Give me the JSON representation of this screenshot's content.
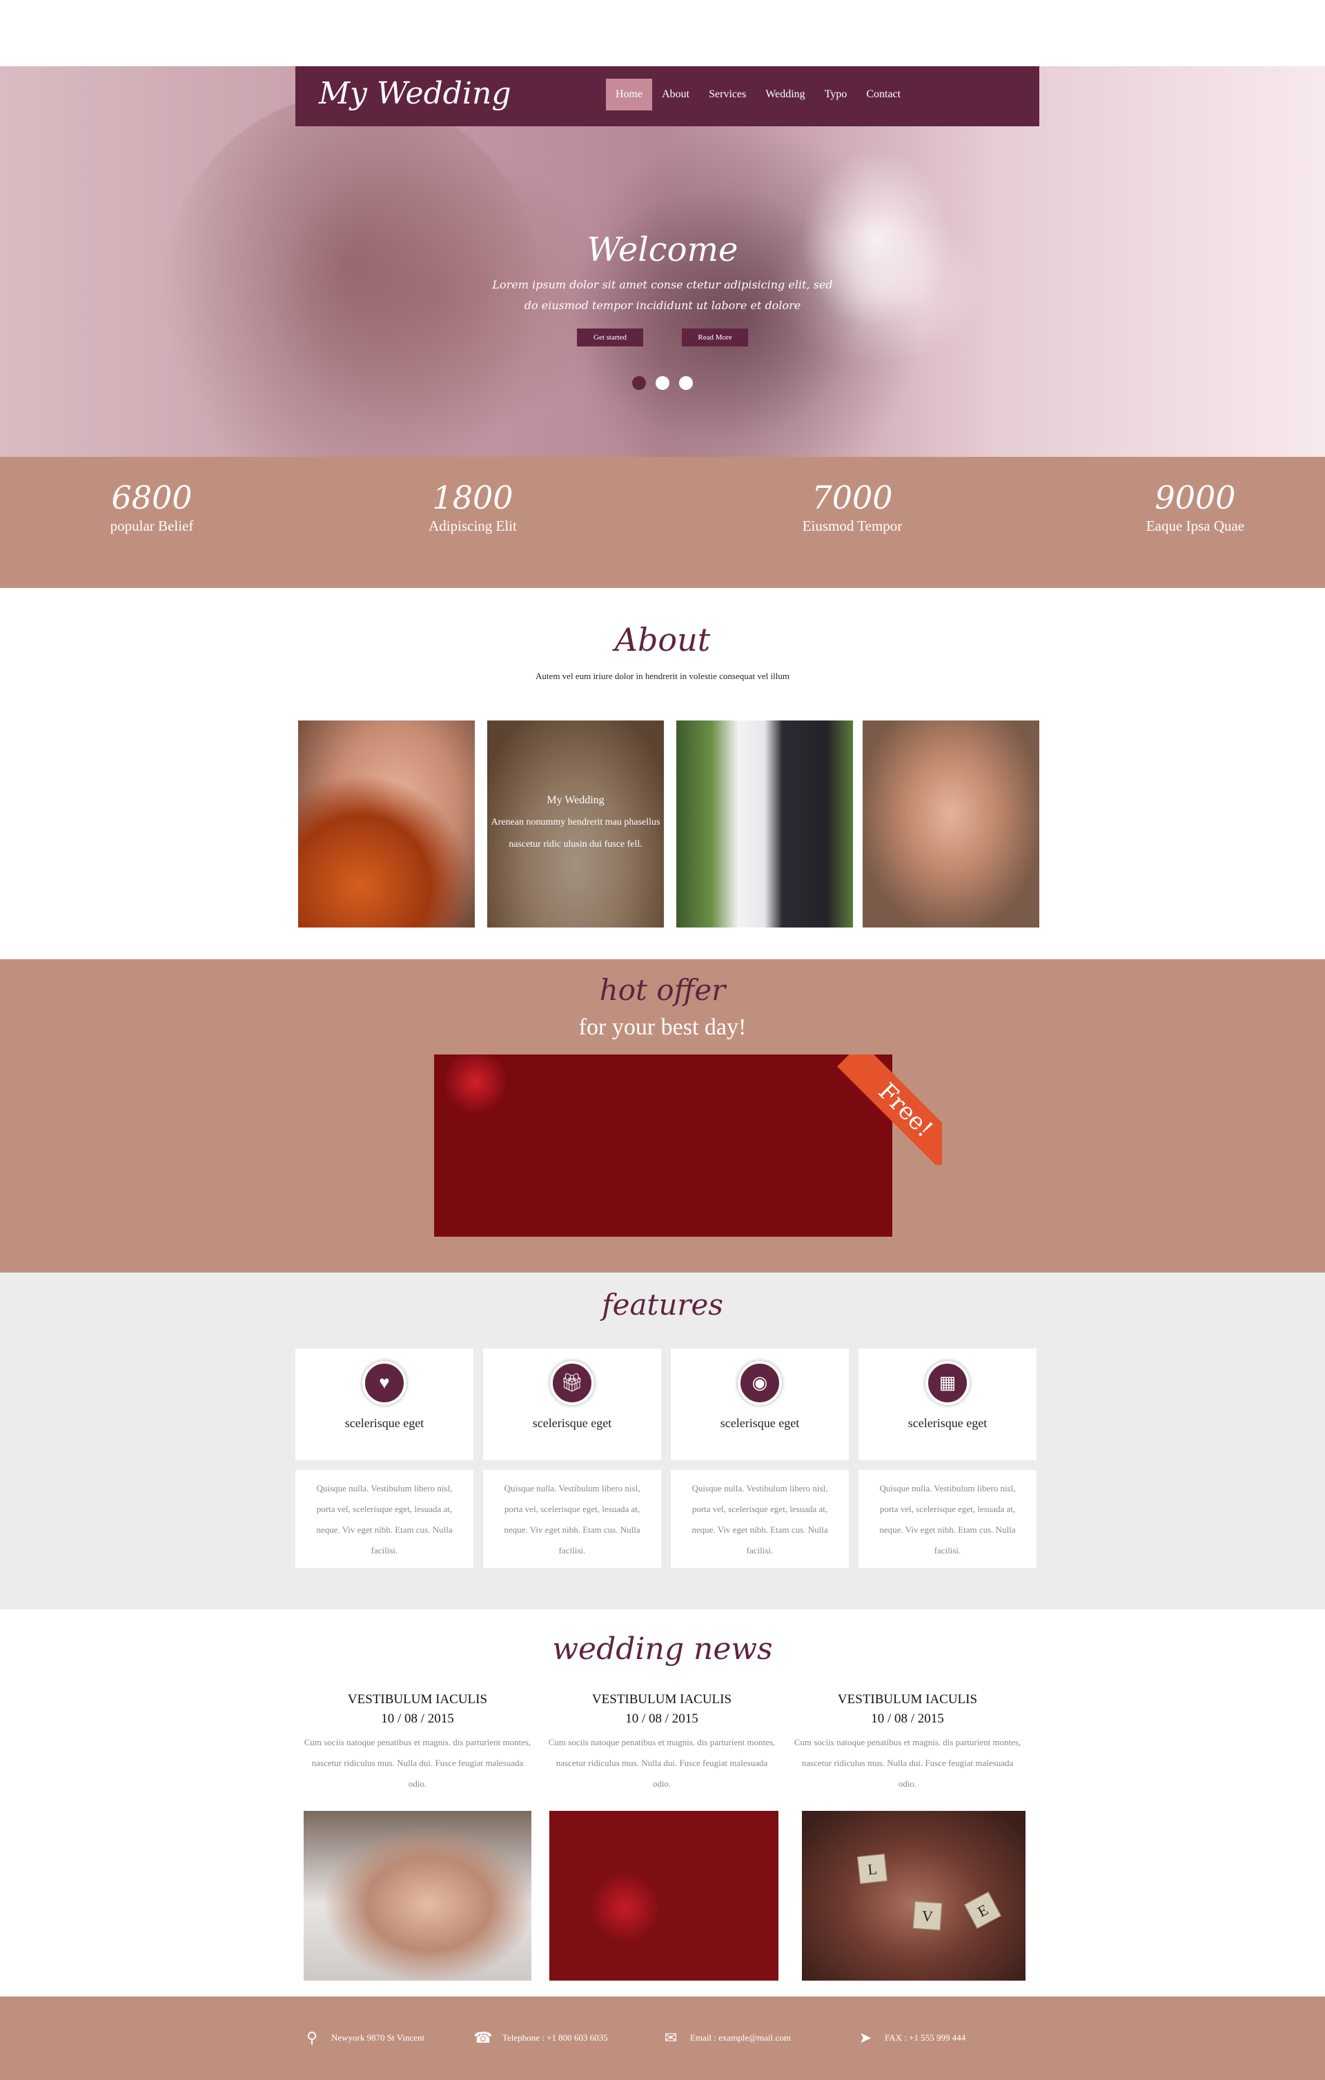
{
  "header": {
    "logo": "My Wedding",
    "nav": [
      {
        "label": "Home",
        "active": true
      },
      {
        "label": "About",
        "active": false
      },
      {
        "label": "Services",
        "active": false
      },
      {
        "label": "Wedding",
        "active": false
      },
      {
        "label": "Typo",
        "active": false
      },
      {
        "label": "Contact",
        "active": false
      }
    ]
  },
  "hero": {
    "title": "Welcome",
    "text": "Lorem ipsum dolor sit amet conse ctetur adipisicing elit, sed do eiusmod tempor incididunt ut labore et dolore",
    "buttons": [
      "Get started",
      "Read More"
    ],
    "slides": 3,
    "active_slide": 0
  },
  "stats": [
    {
      "value": "6800",
      "label": "popular Belief"
    },
    {
      "value": "1800",
      "label": "Adipiscing Elit"
    },
    {
      "value": "7000",
      "label": "Eiusmod Tempor"
    },
    {
      "value": "9000",
      "label": "Eaque Ipsa Quae"
    }
  ],
  "about": {
    "title": "About",
    "subtitle": "Autem vel eum iriure dolor in hendrerit in volestie consequat vel illum",
    "overlay": {
      "title": "My Wedding",
      "text": "Arenean nonummy hendrerit mau phasellus nascetur ridic ulusin dui fusce fell."
    }
  },
  "offer": {
    "title": "hot offer",
    "subtitle": "for your best day!",
    "badge": "Free!"
  },
  "features": {
    "title": "features",
    "items": [
      {
        "icon": "heart-icon",
        "label": "scelerisque eget",
        "text": "Quisque nulla. Vestibulum libero nisl, porta vel, scelerisque eget, lesuada at, neque. Viv eget nibh. Etam cus. Nulla facilisi."
      },
      {
        "icon": "gift-icon",
        "label": "scelerisque eget",
        "text": "Quisque nulla. Vestibulum libero nisl, porta vel, scelerisque eget, lesuada at, neque. Viv eget nibh. Etam cus. Nulla facilisi."
      },
      {
        "icon": "camera-icon",
        "label": "scelerisque eget",
        "text": "Quisque nulla. Vestibulum libero nisl, porta vel, scelerisque eget, lesuada at, neque. Viv eget nibh. Etam cus. Nulla facilisi."
      },
      {
        "icon": "calendar-icon",
        "label": "scelerisque eget",
        "text": "Quisque nulla. Vestibulum libero nisl, porta vel, scelerisque eget, lesuada at, neque. Viv eget nibh. Etam cus. Nulla facilisi."
      }
    ]
  },
  "news": {
    "title": "wedding news",
    "items": [
      {
        "heading": "VESTIBULUM IACULIS",
        "date": "10 / 08 / 2015",
        "text": "Cum sociis natoque penatibus et magnis. dis parturient montes, nascetur ridiculus mus. Nulla dui. Fusce feugiat malesuada odio."
      },
      {
        "heading": "VESTIBULUM IACULIS",
        "date": "10 / 08 / 2015",
        "text": "Cum sociis natoque penatibus et magnis. dis parturient montes, nascetur ridiculus mus. Nulla dui. Fusce feugiat malesuada odio."
      },
      {
        "heading": "VESTIBULUM IACULIS",
        "date": "10 / 08 / 2015",
        "text": "Cum sociis natoque penatibus et magnis. dis parturient montes, nascetur ridiculus mus. Nulla dui. Fusce feugiat malesuada odio."
      }
    ],
    "love_tiles": [
      "L",
      "V",
      "E"
    ]
  },
  "footer": {
    "address": "Newyork 9870 St Vincent",
    "telephone": "Telephone : +1 800 603 6035",
    "email": "Email : example@mail.com",
    "fax": "FAX : +1 555 999 444"
  },
  "colors": {
    "brand": "#5f2440",
    "accent": "#c0907f",
    "nav_active": "#c78a99",
    "badge": "#e5532c",
    "features_bg": "#ececec"
  }
}
